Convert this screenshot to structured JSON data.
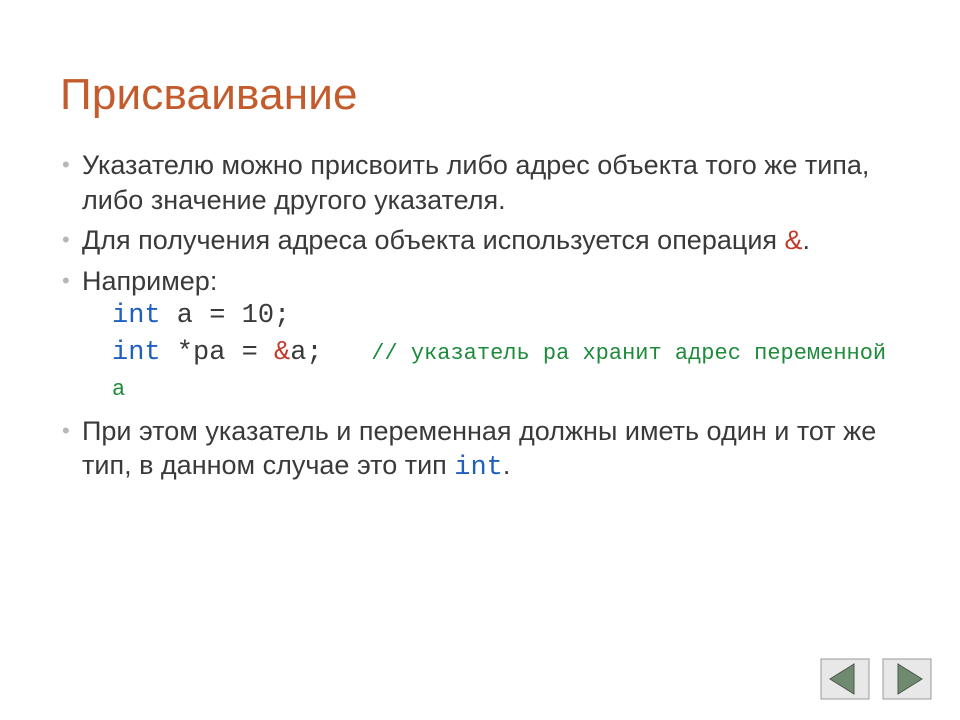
{
  "title": "Присваивание",
  "bullets": {
    "b1": "Указателю можно присвоить либо адрес объекта того же типа, либо значение другого указателя.",
    "b2_pre": "Для получения адреса объекта используется операция ",
    "b2_op": "&",
    "b2_post": ".",
    "b3_intro": "Например:",
    "b3_code1_kw": "int",
    "b3_code1_rest": " a = 10;",
    "b3_code2_kw": "int",
    "b3_code2_mid": " *pa = ",
    "b3_code2_op": "&",
    "b3_code2_end": "a;",
    "b3_comment": "// указатель pa хранит адрес переменной a",
    "b4_pre": "При этом указатель и переменная должны иметь один и тот же тип, в данном случае это тип ",
    "b4_kw": "int",
    "b4_post": "."
  },
  "nav": {
    "prev": "previous-slide",
    "next": "next-slide"
  }
}
